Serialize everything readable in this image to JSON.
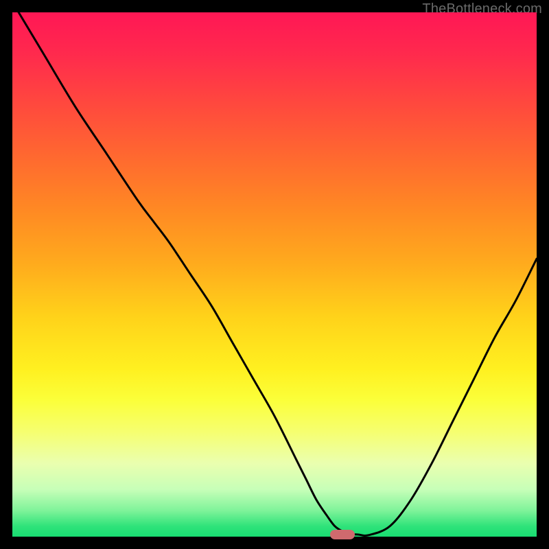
{
  "watermark": "TheBottleneck.com",
  "chart_data": {
    "type": "line",
    "title": "",
    "xlabel": "",
    "ylabel": "",
    "xlim": [
      0,
      100
    ],
    "ylim": [
      0,
      100
    ],
    "grid": false,
    "legend": false,
    "series": [
      {
        "name": "bottleneck-curve",
        "x": [
          0,
          6,
          12,
          18,
          24,
          27,
          30,
          34,
          38,
          42,
          46,
          50,
          54,
          56,
          58,
          60,
          61.5,
          63,
          64.5,
          66,
          68,
          72,
          76,
          80,
          84,
          88,
          92,
          96,
          100
        ],
        "y": [
          102,
          92,
          82,
          73,
          64,
          60,
          56,
          50,
          44,
          37,
          30,
          23,
          15,
          11,
          7,
          4,
          2,
          1,
          0.5,
          0.4,
          0.3,
          2,
          7,
          14,
          22,
          30,
          38,
          45,
          53
        ],
        "color": "#000000"
      }
    ],
    "marker": {
      "x": 63,
      "y": 0.4,
      "color": "#cf6a6e"
    },
    "background_gradient": {
      "top": "#ff1755",
      "mid": "#ffd21a",
      "bottom": "#18dc71"
    }
  }
}
